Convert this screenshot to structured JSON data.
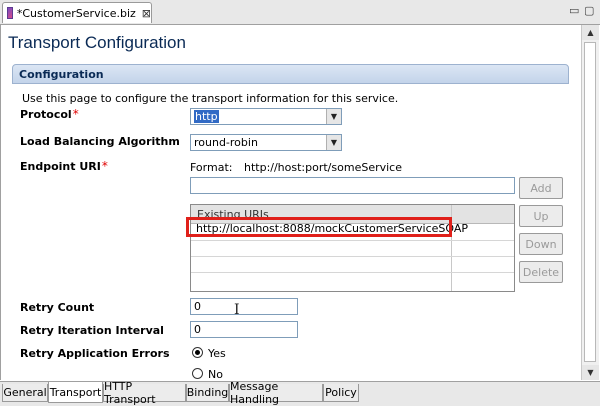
{
  "editor_tab": {
    "title": "*CustomerService.biz",
    "close": "⊠"
  },
  "window_controls": {
    "minimize": "▭",
    "maximize": "▢"
  },
  "page": {
    "title": "Transport Configuration"
  },
  "section": {
    "title": "Configuration",
    "intro": "Use this page to configure the transport information for this service."
  },
  "fields": {
    "protocol": {
      "label": "Protocol",
      "required": "*",
      "value": "http"
    },
    "load_balancing": {
      "label": "Load Balancing Algorithm",
      "value": "round-robin"
    },
    "endpoint": {
      "label": "Endpoint URI",
      "required": "*",
      "format_label": "Format:",
      "format_value": "http://host:port/someService",
      "input_value": ""
    },
    "retry_count": {
      "label": "Retry Count",
      "value": "0"
    },
    "retry_interval": {
      "label": "Retry Iteration Interval",
      "value": "0"
    },
    "retry_app_errors": {
      "label": "Retry Application Errors",
      "options": [
        "Yes",
        "No"
      ],
      "selected": "Yes"
    }
  },
  "uri_table": {
    "header": "Existing URIs",
    "rows": [
      "http://localhost:8088/mockCustomerServiceSOAP"
    ]
  },
  "buttons": {
    "add": "Add",
    "up": "Up",
    "down": "Down",
    "delete": "Delete"
  },
  "bottom_tabs": [
    "General",
    "Transport",
    "HTTP Transport",
    "Binding",
    "Message Handling",
    "Policy"
  ],
  "active_bottom_tab": "Transport",
  "colors": {
    "title": "#0a2a55",
    "required": "#e00000",
    "highlight": "#e0201a",
    "selection": "#316ac5"
  }
}
